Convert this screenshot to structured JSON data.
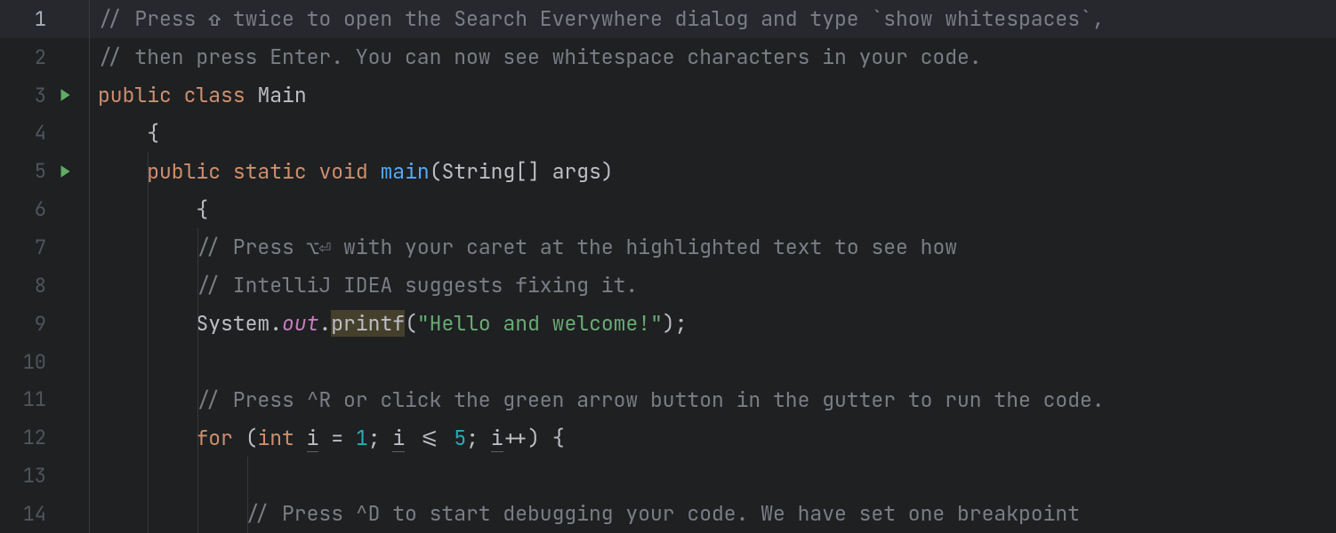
{
  "editor": {
    "current_line": 1,
    "lines": [
      {
        "n": 1,
        "run": false,
        "indent_guides": [],
        "tokens": [
          {
            "c": "tk-comment",
            "t": "// Press ⇧ twice to open the Search Everywhere dialog and type `show whitespaces`,"
          }
        ]
      },
      {
        "n": 2,
        "run": false,
        "indent_guides": [],
        "tokens": [
          {
            "c": "tk-comment",
            "t": "// then press Enter. You can now see whitespace characters in your code."
          }
        ]
      },
      {
        "n": 3,
        "run": true,
        "indent_guides": [],
        "tokens": [
          {
            "c": "tk-keyword",
            "t": "public"
          },
          {
            "c": "tk-default",
            "t": " "
          },
          {
            "c": "tk-keyword",
            "t": "class"
          },
          {
            "c": "tk-default",
            "t": " "
          },
          {
            "c": "tk-class",
            "t": "Main"
          }
        ]
      },
      {
        "n": 4,
        "run": false,
        "indent_guides": [],
        "tokens": [
          {
            "c": "tk-default",
            "t": "    "
          },
          {
            "c": "tk-punc",
            "t": "{"
          }
        ]
      },
      {
        "n": 5,
        "run": true,
        "indent_guides": [
          56
        ],
        "tokens": [
          {
            "c": "tk-default",
            "t": "    "
          },
          {
            "c": "tk-keyword",
            "t": "public"
          },
          {
            "c": "tk-default",
            "t": " "
          },
          {
            "c": "tk-keyword",
            "t": "static"
          },
          {
            "c": "tk-default",
            "t": " "
          },
          {
            "c": "tk-keyword",
            "t": "void"
          },
          {
            "c": "tk-default",
            "t": " "
          },
          {
            "c": "tk-method",
            "t": "main"
          },
          {
            "c": "tk-punc",
            "t": "("
          },
          {
            "c": "tk-default",
            "t": "String"
          },
          {
            "c": "tk-punc",
            "t": "[]"
          },
          {
            "c": "tk-default",
            "t": " args"
          },
          {
            "c": "tk-punc",
            "t": ")"
          }
        ]
      },
      {
        "n": 6,
        "run": false,
        "indent_guides": [
          56
        ],
        "tokens": [
          {
            "c": "tk-default",
            "t": "        "
          },
          {
            "c": "tk-punc",
            "t": "{"
          }
        ]
      },
      {
        "n": 7,
        "run": false,
        "indent_guides": [
          56,
          112
        ],
        "tokens": [
          {
            "c": "tk-default",
            "t": "        "
          },
          {
            "c": "tk-comment",
            "t": "// Press ⌥⏎ with your caret at the highlighted text to see how"
          }
        ]
      },
      {
        "n": 8,
        "run": false,
        "indent_guides": [
          56,
          112
        ],
        "tokens": [
          {
            "c": "tk-default",
            "t": "        "
          },
          {
            "c": "tk-comment",
            "t": "// IntelliJ IDEA suggests fixing it."
          }
        ]
      },
      {
        "n": 9,
        "run": false,
        "indent_guides": [
          56,
          112
        ],
        "tokens": [
          {
            "c": "tk-default",
            "t": "        "
          },
          {
            "c": "tk-default",
            "t": "System"
          },
          {
            "c": "tk-punc",
            "t": "."
          },
          {
            "c": "tk-field",
            "t": "out"
          },
          {
            "c": "tk-punc",
            "t": "."
          },
          {
            "c": "tk-call warn-bg",
            "t": "printf"
          },
          {
            "c": "tk-punc",
            "t": "("
          },
          {
            "c": "tk-string",
            "t": "\"Hello and welcome!\""
          },
          {
            "c": "tk-punc",
            "t": ")"
          },
          {
            "c": "tk-punc",
            "t": ";"
          }
        ]
      },
      {
        "n": 10,
        "run": false,
        "indent_guides": [
          56,
          112
        ],
        "tokens": []
      },
      {
        "n": 11,
        "run": false,
        "indent_guides": [
          56,
          112
        ],
        "tokens": [
          {
            "c": "tk-default",
            "t": "        "
          },
          {
            "c": "tk-comment",
            "t": "// Press ^R or click the green arrow button in the gutter to run the code."
          }
        ]
      },
      {
        "n": 12,
        "run": false,
        "indent_guides": [
          56,
          112
        ],
        "tokens": [
          {
            "c": "tk-default",
            "t": "        "
          },
          {
            "c": "tk-keyword",
            "t": "for"
          },
          {
            "c": "tk-default",
            "t": " "
          },
          {
            "c": "tk-punc",
            "t": "("
          },
          {
            "c": "tk-keyword",
            "t": "int"
          },
          {
            "c": "tk-default",
            "t": " "
          },
          {
            "c": "tk-default underline",
            "t": "i"
          },
          {
            "c": "tk-default",
            "t": " "
          },
          {
            "c": "tk-punc",
            "t": "="
          },
          {
            "c": "tk-default",
            "t": " "
          },
          {
            "c": "tk-number",
            "t": "1"
          },
          {
            "c": "tk-punc",
            "t": ";"
          },
          {
            "c": "tk-default",
            "t": " "
          },
          {
            "c": "tk-default underline",
            "t": "i"
          },
          {
            "c": "tk-default",
            "t": " "
          },
          {
            "c": "tk-punc",
            "t": "<="
          },
          {
            "c": "tk-default",
            "t": " "
          },
          {
            "c": "tk-number",
            "t": "5"
          },
          {
            "c": "tk-punc",
            "t": ";"
          },
          {
            "c": "tk-default",
            "t": " "
          },
          {
            "c": "tk-default underline",
            "t": "i"
          },
          {
            "c": "tk-punc",
            "t": "++)"
          },
          {
            "c": "tk-default",
            "t": " "
          },
          {
            "c": "tk-punc",
            "t": "{"
          }
        ]
      },
      {
        "n": 13,
        "run": false,
        "indent_guides": [
          56,
          112,
          168
        ],
        "tokens": []
      },
      {
        "n": 14,
        "run": false,
        "indent_guides": [
          56,
          112,
          168
        ],
        "tokens": [
          {
            "c": "tk-default",
            "t": "            "
          },
          {
            "c": "tk-comment",
            "t": "// Press ^D to start debugging your code. We have set one breakpoint"
          }
        ]
      }
    ]
  }
}
